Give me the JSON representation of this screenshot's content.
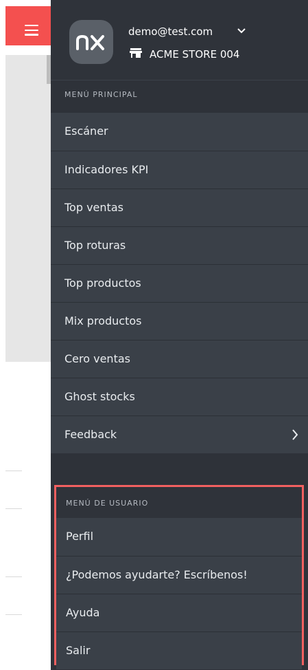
{
  "account": {
    "email": "demo@test.com",
    "store": "ACME STORE 004",
    "logo_text": "nx"
  },
  "main_menu": {
    "title": "MENÚ PRINCIPAL",
    "items": [
      {
        "label": "Escáner"
      },
      {
        "label": "Indicadores KPI"
      },
      {
        "label": "Top ventas"
      },
      {
        "label": "Top roturas"
      },
      {
        "label": "Top productos"
      },
      {
        "label": "Mix productos"
      },
      {
        "label": "Cero ventas"
      },
      {
        "label": "Ghost stocks"
      },
      {
        "label": "Feedback"
      }
    ]
  },
  "user_menu": {
    "title": "MENÚ DE USUARIO",
    "items": [
      {
        "label": "Perfil"
      },
      {
        "label": "¿Podemos ayudarte? Escríbenos!"
      },
      {
        "label": "Ayuda"
      },
      {
        "label": "Salir"
      }
    ]
  },
  "colors": {
    "accent": "#f4504f",
    "drawer_bg": "#2e3239",
    "menu_bg": "#3a4048",
    "highlight_border": "#f26060"
  }
}
